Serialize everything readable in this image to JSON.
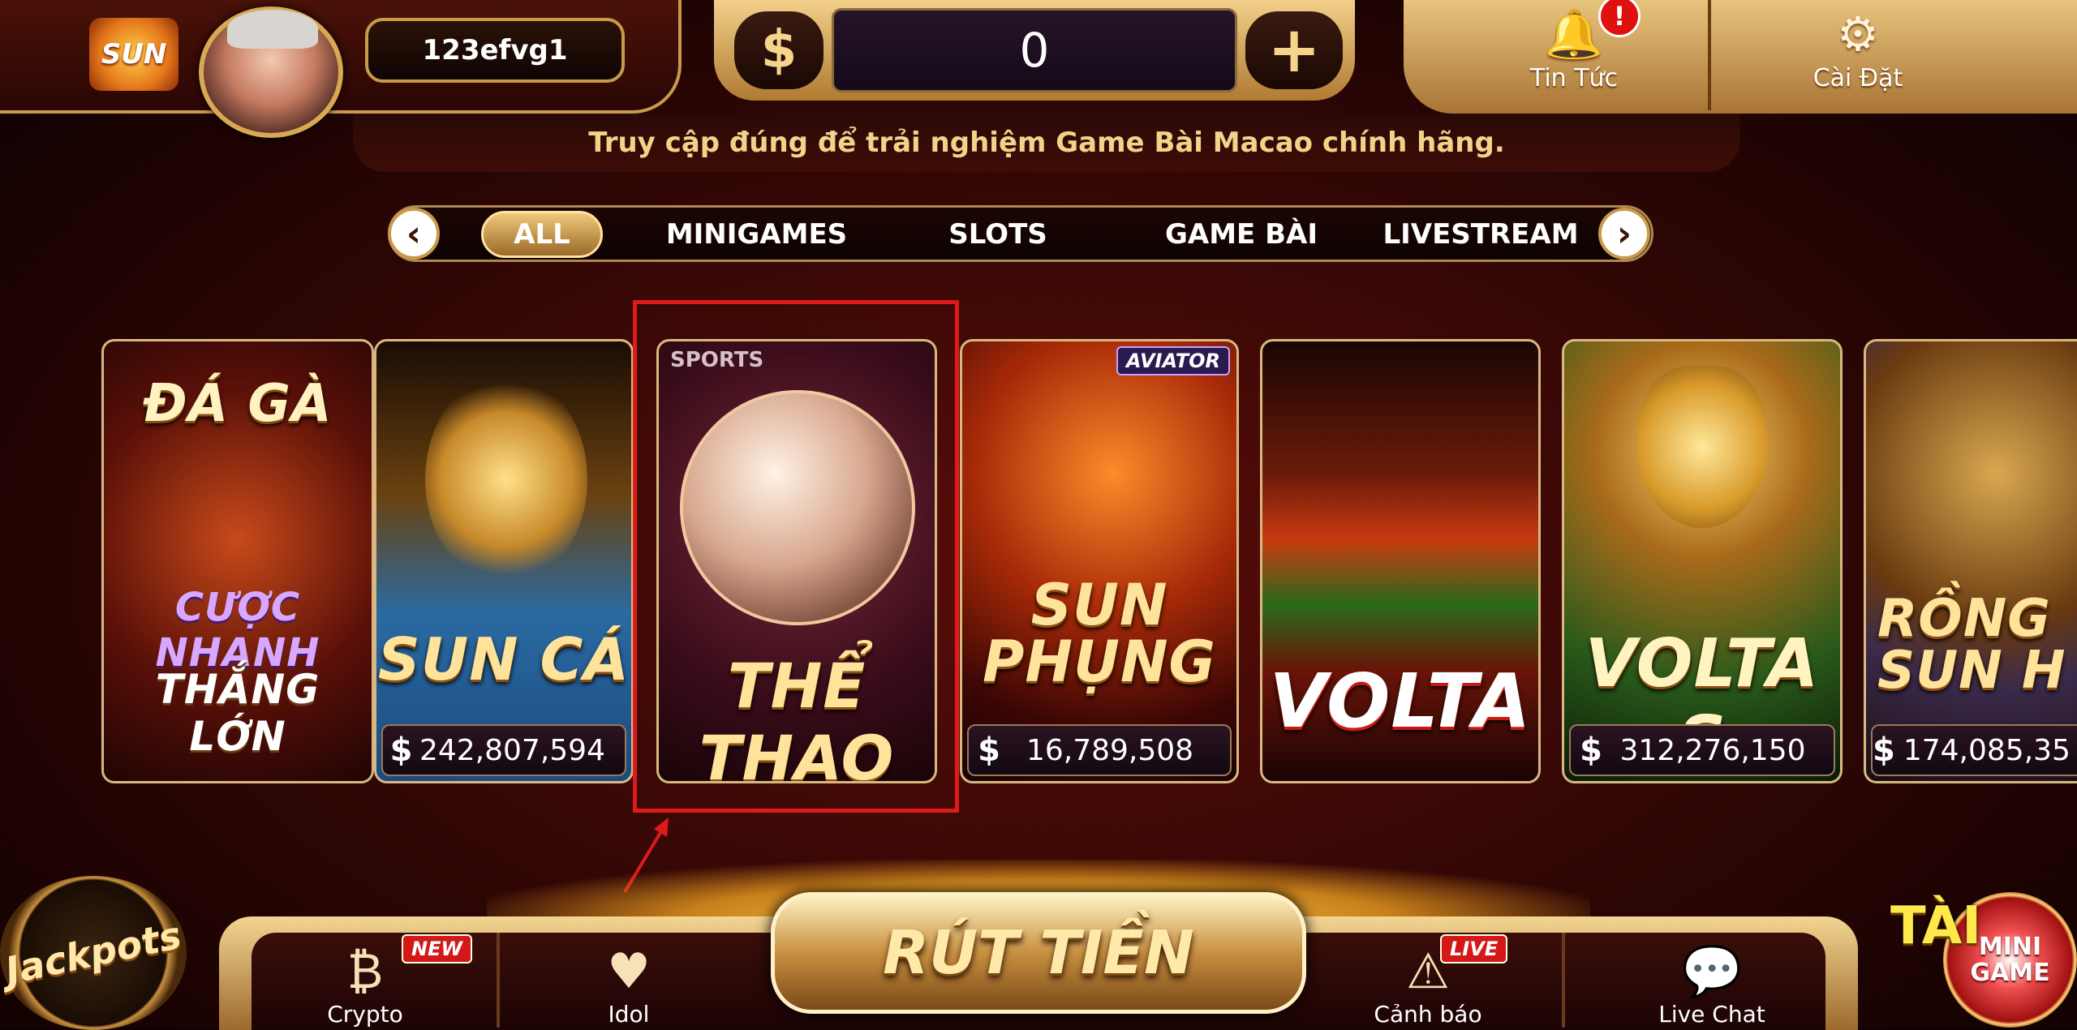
{
  "header": {
    "logo_text": "SUN",
    "username": "123efvg1",
    "balance": "0",
    "currency_symbol": "$",
    "plus_symbol": "+",
    "news_label": "Tin Tức",
    "news_badge": "!",
    "settings_label": "Cài Đặt"
  },
  "notice": "Truy cập đúng để trải nghiệm Game Bài Macao chính hãng.",
  "tabs": {
    "prev": "‹",
    "next": "›",
    "items": [
      "ALL",
      "MINIGAMES",
      "SLOTS",
      "GAME BÀI",
      "LIVESTREAM"
    ],
    "active": "ALL"
  },
  "games": [
    {
      "line1": "ĐÁ GÀ",
      "line2": "CƯỢC NHANH",
      "line3": "THẮNG LỚN"
    },
    {
      "title": "SUN CÁ",
      "jackpot": "242,807,594"
    },
    {
      "title": "THỂ THAO",
      "badge": "SPORTS"
    },
    {
      "title": "SUN PHỤNG",
      "badge": "AVIATOR",
      "jackpot": "16,789,508"
    },
    {
      "title": "VOLTA"
    },
    {
      "title": "VOLTA S",
      "jackpot": "312,276,150"
    },
    {
      "title": "RỒNG SUN H",
      "jackpot": "174,085,35"
    }
  ],
  "bottom": {
    "crypto": "Crypto",
    "crypto_tag": "NEW",
    "idol": "Idol",
    "withdraw": "RÚT TIỀN",
    "warning": "Cảnh báo",
    "warning_tag": "LIVE",
    "live_chat": "Live Chat",
    "jackpots": "Jackpots",
    "tai": "TÀI",
    "minigame": "MINI GAME"
  },
  "colors": {
    "accent_gold": "#c89a4a",
    "highlight_red": "#e01a1a",
    "background": "#3a0806"
  }
}
